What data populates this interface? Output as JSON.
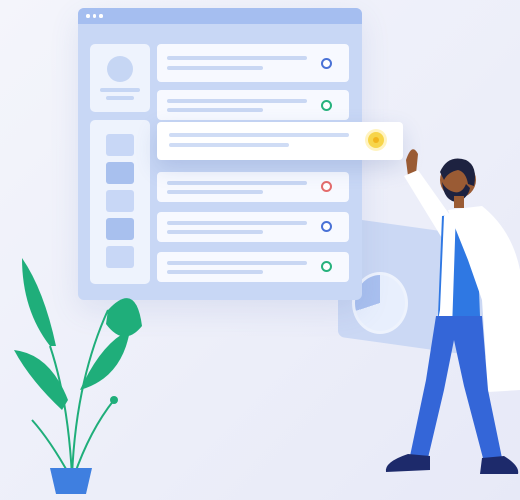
{
  "illustration": {
    "description_labels": [],
    "colors": {
      "window": "#c8d7f5",
      "card": "#f7f9ff",
      "accent_blue": "#4a72d6",
      "accent_green": "#27b27d",
      "accent_red": "#e46c6c",
      "accent_yellow": "#f2c12e",
      "plant": "#1fae7a",
      "pot": "#3f7fe0",
      "coat": "#ffffff",
      "pants": "#3466d8",
      "shirt": "#2f78e3",
      "skin": "#9a5b34"
    },
    "rows": [
      {
        "status_icon": "circle-icon",
        "status_color": "#4a72d6"
      },
      {
        "status_icon": "circle-icon",
        "status_color": "#27b27d"
      },
      {
        "status_icon": "circle-icon",
        "status_color": "#e46c6c"
      },
      {
        "status_icon": "circle-icon",
        "status_color": "#4a72d6"
      },
      {
        "status_icon": "circle-icon",
        "status_color": "#27b27d"
      }
    ],
    "popup": {
      "status_icon": "circle-icon",
      "status_color": "#f2c12e"
    }
  }
}
